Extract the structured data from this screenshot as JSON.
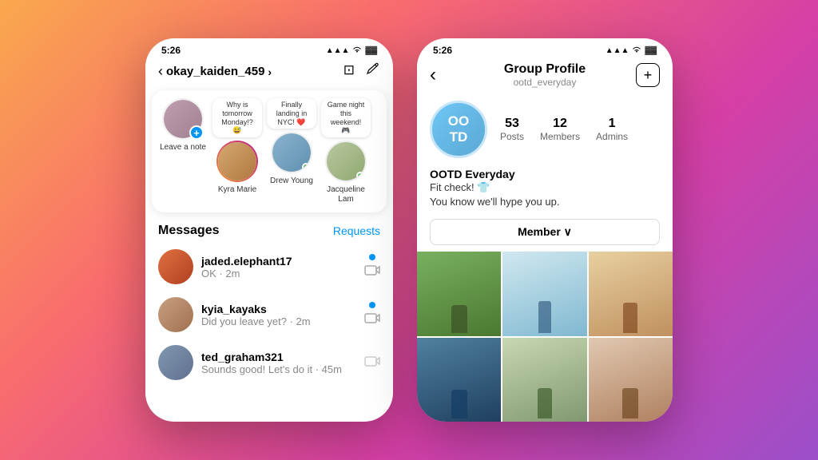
{
  "background": {
    "gradient": "linear-gradient(135deg, #f9a84d 0%, #f96d6d 30%, #d63fa5 65%, #9b4fca 100%)"
  },
  "left_phone": {
    "status_bar": {
      "time": "5:26",
      "signal": "▲▲▲",
      "wifi": "wifi",
      "battery": "battery"
    },
    "nav": {
      "title": "okay_kaiden_459",
      "chevron": "›",
      "icon1": "⬜",
      "icon2": "✏️"
    },
    "stories": [
      {
        "id": "add",
        "name": "Leave a note",
        "is_add": true
      },
      {
        "id": "kyra",
        "name": "Kyra Marie",
        "note": "Why is tomorrow Monday!? 😅",
        "has_gradient": true
      },
      {
        "id": "drew",
        "name": "Drew Young",
        "note": "Finally landing in NYC! ❤️",
        "online": true
      },
      {
        "id": "jacqueline",
        "name": "Jacqueline Lam",
        "note": "Game night this weekend! 🎮",
        "online": true
      }
    ],
    "messages": {
      "title": "Messages",
      "requests": "Requests",
      "items": [
        {
          "username": "jaded.elephant17",
          "preview": "OK · 2m",
          "unread": true,
          "has_camera": true
        },
        {
          "username": "kyia_kayaks",
          "preview": "Did you leave yet? · 2m",
          "unread": true,
          "has_camera": true
        },
        {
          "username": "ted_graham321",
          "preview": "Sounds good! Let's do it · 45m",
          "unread": false,
          "has_camera": true
        }
      ]
    }
  },
  "right_phone": {
    "status_bar": {
      "time": "5:26",
      "signal": "▲▲▲",
      "wifi": "wifi",
      "battery": "battery"
    },
    "nav": {
      "back": "‹",
      "title": "Group Profile",
      "subtitle": "ootd_everyday",
      "add_icon": "+"
    },
    "group": {
      "avatar_text": "OO\nTD",
      "stats": [
        {
          "number": "53",
          "label": "Posts"
        },
        {
          "number": "12",
          "label": "Members"
        },
        {
          "number": "1",
          "label": "Admins"
        }
      ],
      "name": "OOTD Everyday",
      "bio_line1": "Fit check! 👕",
      "bio_line2": "You know we'll hype you up.",
      "member_button": "Member ∨"
    },
    "photos": [
      {
        "id": 1,
        "color_class": "photo-1"
      },
      {
        "id": 2,
        "color_class": "photo-2"
      },
      {
        "id": 3,
        "color_class": "photo-3"
      },
      {
        "id": 4,
        "color_class": "photo-4"
      },
      {
        "id": 5,
        "color_class": "photo-5"
      },
      {
        "id": 6,
        "color_class": "photo-6"
      }
    ]
  }
}
